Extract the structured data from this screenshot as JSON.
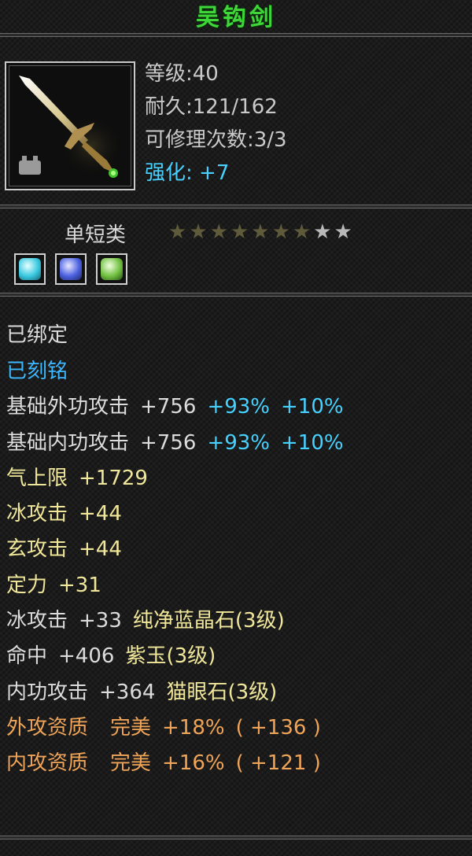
{
  "item": {
    "name": "吴钩剑",
    "stats": {
      "level": "等级:40",
      "durability": "耐久:121/162",
      "repairs": "可修理次数:3/3",
      "enhance_label": "强化:",
      "enhance_value": "+7"
    },
    "category": "单短类",
    "stars": {
      "total": 9,
      "dim": 7,
      "lit": 2
    },
    "gems": [
      {
        "icon": "cyan-gem-icon",
        "color": "#38c8e0"
      },
      {
        "icon": "blue-gem-icon",
        "color": "#4a60e0"
      },
      {
        "icon": "green-gem-icon",
        "color": "#70c040"
      }
    ],
    "attributes": {
      "bound": "已绑定",
      "engraved": "已刻铭",
      "ext_attack": {
        "label": "基础外功攻击",
        "value": "+756",
        "pct1": "+93%",
        "pct2": "+10%"
      },
      "int_attack": {
        "label": "基础内功攻击",
        "value": "+756",
        "pct1": "+93%",
        "pct2": "+10%"
      },
      "qi_max": {
        "label": "气上限",
        "value": "+1729"
      },
      "ice_attack": {
        "label": "冰攻击",
        "value": "+44"
      },
      "xuan_attack": {
        "label": "玄攻击",
        "value": "+44"
      },
      "focus": {
        "label": "定力",
        "value": "+31"
      },
      "gem_ice": {
        "label": "冰攻击",
        "value": "+33",
        "gem": "纯净蓝晶石",
        "grade": "(3级)"
      },
      "gem_hit": {
        "label": "命中",
        "value": "+406",
        "gem": "紫玉",
        "grade": "(3级)"
      },
      "gem_int": {
        "label": "内功攻击",
        "value": "+364",
        "gem": "猫眼石",
        "grade": "(3级)"
      },
      "ext_quality": {
        "label": "外攻资质",
        "grade": "完美",
        "pct": "+18%",
        "bonus": "( +136 )"
      },
      "int_quality": {
        "label": "内攻资质",
        "grade": "完美",
        "pct": "+16%",
        "bonus": "( +121 )"
      }
    }
  },
  "colors": {
    "title": "#3fd63a",
    "blue": "#3db8ff",
    "yellow": "#f0e79a",
    "orange": "#f0a458"
  }
}
